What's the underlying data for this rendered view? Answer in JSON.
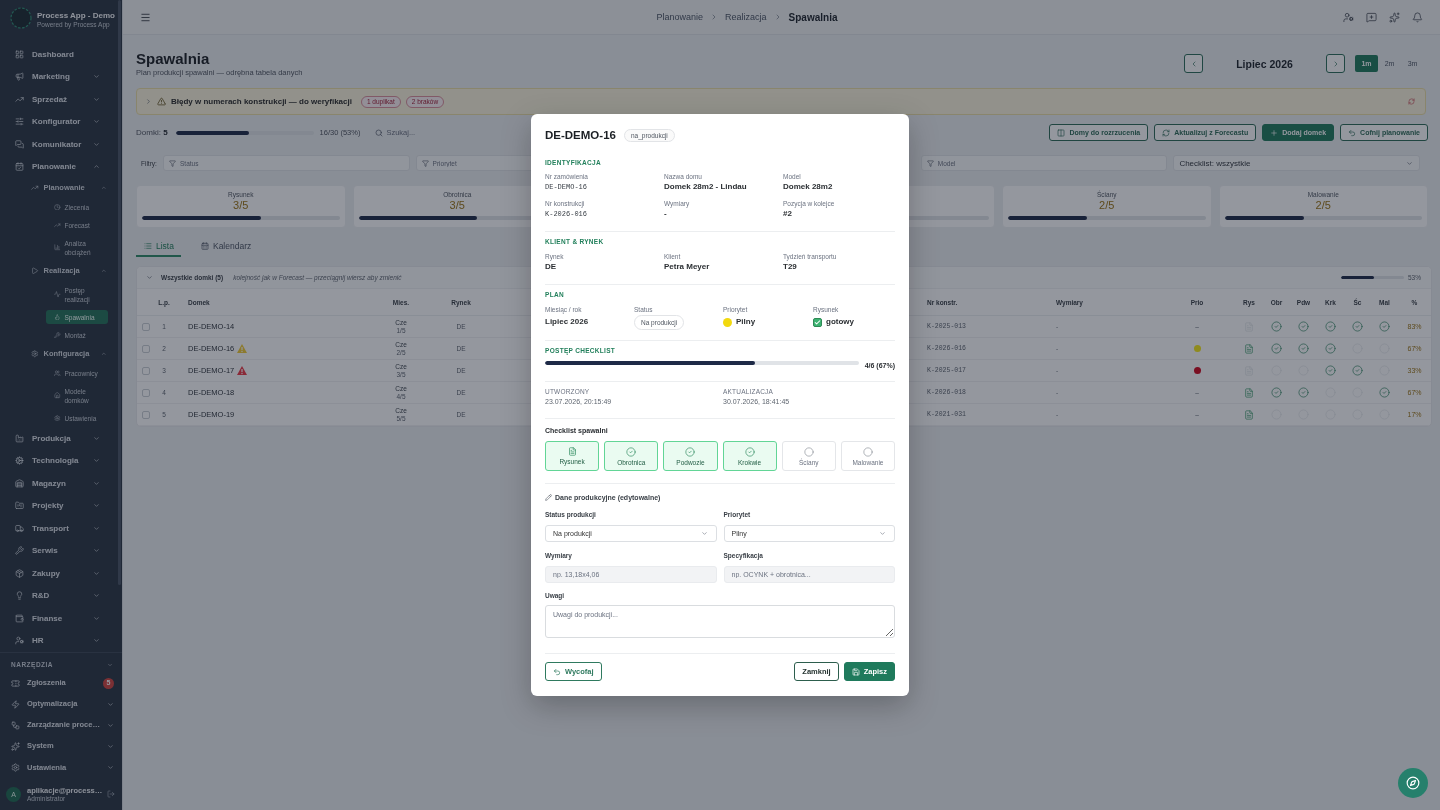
{
  "sidebar": {
    "brand": {
      "title": "Process App - Demo",
      "subtitle": "Powered by Process App"
    },
    "items": [
      {
        "kind": "link",
        "label": "Dashboard",
        "selected": false
      },
      {
        "kind": "group",
        "label": "Marketing",
        "expanded": false
      },
      {
        "kind": "group",
        "label": "Sprzedaż",
        "expanded": false
      },
      {
        "kind": "group",
        "label": "Konfigurator",
        "expanded": false
      },
      {
        "kind": "group",
        "label": "Komunikator",
        "expanded": false
      },
      {
        "kind": "group",
        "label": "Planowanie",
        "expanded": true,
        "children": [
          {
            "kind": "group",
            "label": "Planowanie",
            "expanded": true,
            "children": [
              {
                "kind": "link",
                "label": "Zlecenia",
                "selected": false
              },
              {
                "kind": "link",
                "label": "Forecast",
                "selected": false
              },
              {
                "kind": "link",
                "label": "Analiza obciążeń",
                "selected": false
              }
            ]
          },
          {
            "kind": "group",
            "label": "Realizacja",
            "expanded": true,
            "children": [
              {
                "kind": "link",
                "label": "Postęp realizacji",
                "selected": false
              },
              {
                "kind": "link",
                "label": "Spawalnia",
                "selected": true
              },
              {
                "kind": "link",
                "label": "Montaż",
                "selected": false
              }
            ]
          },
          {
            "kind": "group",
            "label": "Konfiguracja",
            "expanded": true,
            "children": [
              {
                "kind": "link",
                "label": "Pracownicy",
                "selected": false
              },
              {
                "kind": "link",
                "label": "Modele domków",
                "selected": false
              },
              {
                "kind": "link",
                "label": "Ustawienia",
                "selected": false
              }
            ]
          }
        ]
      },
      {
        "kind": "group",
        "label": "Produkcja",
        "expanded": false
      },
      {
        "kind": "group",
        "label": "Technologia",
        "expanded": false
      },
      {
        "kind": "group",
        "label": "Magazyn",
        "expanded": false
      },
      {
        "kind": "group",
        "label": "Projekty",
        "expanded": false
      },
      {
        "kind": "group",
        "label": "Transport",
        "expanded": false
      },
      {
        "kind": "group",
        "label": "Serwis",
        "expanded": false
      },
      {
        "kind": "group",
        "label": "Zakupy",
        "expanded": false
      },
      {
        "kind": "group",
        "label": "R&D",
        "expanded": false
      },
      {
        "kind": "group",
        "label": "Finanse",
        "expanded": false
      },
      {
        "kind": "group",
        "label": "HR",
        "expanded": false
      }
    ],
    "tools": {
      "title": "NARZĘDZIA",
      "items": [
        {
          "kind": "link",
          "label": "Zgłoszenia",
          "selected": false,
          "badge": "5"
        },
        {
          "kind": "group",
          "label": "Optymalizacja",
          "expanded": false
        },
        {
          "kind": "group",
          "label": "Zarządzanie proce…",
          "expanded": false
        },
        {
          "kind": "group",
          "label": "System",
          "expanded": false
        },
        {
          "kind": "group",
          "label": "Ustawienia",
          "expanded": false
        }
      ]
    },
    "user": {
      "initial": "A",
      "email": "aplikacje@process…",
      "role": "Administrator"
    }
  },
  "breadcrumb": [
    {
      "label": "Planowanie",
      "current": false
    },
    {
      "label": "Realizacja",
      "current": false
    },
    {
      "label": "Spawalnia",
      "current": true
    }
  ],
  "page": {
    "title": "Spawalnia",
    "subtitle": "Plan produkcji spawalni — odrębna tabela danych"
  },
  "period": {
    "label": "Lipiec 2026",
    "ranges": [
      {
        "label": "1m",
        "selected": true
      },
      {
        "label": "2m",
        "selected": false
      },
      {
        "label": "3m",
        "selected": false
      }
    ]
  },
  "banner": {
    "expanded": false,
    "text": "Błędy w numerach konstrukcji — do weryfikacji",
    "badges": [
      "1 duplikat",
      "2 braków"
    ]
  },
  "summary": {
    "label": "Domki: **5**",
    "level": 0.53,
    "reading": "16/30 (53%)",
    "search": {
      "placeholder": "Szukaj..."
    }
  },
  "actions": [
    {
      "kind": "outline",
      "label": "Domy do rozrzucenia"
    },
    {
      "kind": "outline",
      "label": "Aktualizuj z Forecastu"
    },
    {
      "kind": "primary",
      "label": "Dodaj domek"
    },
    {
      "kind": "outline",
      "label": "Cofnij planowanie"
    }
  ],
  "filters": {
    "label": "Filtry:",
    "fields_left": [
      {
        "placeholder": "Status"
      },
      {
        "placeholder": "Priorytet"
      }
    ],
    "fields_right": [
      {
        "placeholder": "Model"
      }
    ],
    "checklist": {
      "value": "Checklist: wszystkie"
    }
  },
  "stats": {
    "left": [
      {
        "label": "Rysunek",
        "value": "3/5",
        "level": 0.6
      },
      {
        "label": "Obrotnica",
        "value": "3/5",
        "level": 0.6
      }
    ],
    "right": [
      {
        "label": "Ściany",
        "value": "2/5",
        "level": 0.4
      },
      {
        "label": "Malowanie",
        "value": "2/5",
        "level": 0.4
      }
    ]
  },
  "tabs": [
    {
      "label": "Lista",
      "selected": true
    },
    {
      "label": "Kalendarz",
      "selected": false
    }
  ],
  "table": {
    "group": {
      "expanded": true,
      "title": "Wszystkie domki (5)",
      "note": "kolejność jak w Forecast — przeciągnij wiersz aby zmienić",
      "level": 0.53,
      "reading": "53%"
    },
    "columns_left": [
      "L.p.",
      "Domek",
      "Mies.",
      "Rynek"
    ],
    "columns_right": [
      "Nr konstr.",
      "Wymiary",
      "Prio",
      "Rys",
      "Obr",
      "Pdw",
      "Krk",
      "Śc",
      "Mal",
      "%"
    ],
    "rows": [
      {
        "checked": false,
        "lp": "1",
        "house": "DE-DEMO-14",
        "month": "Cze",
        "sequence": "1/5",
        "market": "DE",
        "construction_no": "K-2025-013",
        "dimensions": "-",
        "priority": {
          "kind": "none",
          "text": "–"
        },
        "drawing": false,
        "checks": [
          true,
          true,
          true,
          true,
          true
        ],
        "percent": "83%"
      },
      {
        "checked": false,
        "lp": "2",
        "house": "DE-DEMO-16",
        "alert": {
          "color": "#8c7a2e"
        },
        "month": "Cze",
        "sequence": "2/5",
        "market": "DE",
        "construction_no": "K-2026-016",
        "dimensions": "-",
        "priority": {
          "kind": "dot",
          "color": "#8f8b1e"
        },
        "drawing": true,
        "checks": [
          true,
          true,
          true,
          false,
          false
        ],
        "percent": "67%"
      },
      {
        "checked": false,
        "lp": "3",
        "house": "DE-DEMO-17",
        "alert": {
          "color": "#8a2a38"
        },
        "month": "Cze",
        "sequence": "3/5",
        "market": "DE",
        "construction_no": "K-2025-017",
        "dimensions": "-",
        "priority": {
          "kind": "dot",
          "color": "#7a0f22"
        },
        "drawing": false,
        "checks": [
          false,
          false,
          true,
          true,
          false
        ],
        "percent": "33%"
      },
      {
        "checked": false,
        "lp": "4",
        "house": "DE-DEMO-18",
        "month": "Cze",
        "sequence": "4/5",
        "market": "DE",
        "construction_no": "K-2026-018",
        "dimensions": "-",
        "priority": {
          "kind": "none",
          "text": "–"
        },
        "drawing": true,
        "checks": [
          true,
          true,
          false,
          false,
          true
        ],
        "percent": "67%"
      },
      {
        "checked": false,
        "lp": "5",
        "house": "DE-DEMO-19",
        "month": "Cze",
        "sequence": "5/5",
        "market": "DE",
        "construction_no": "K-2021-031",
        "dimensions": "-",
        "priority": {
          "kind": "none",
          "text": "–"
        },
        "drawing": true,
        "checks": [
          false,
          false,
          false,
          false,
          false
        ],
        "percent": "17%"
      }
    ]
  },
  "modal": {
    "title": "DE-DEMO-16",
    "status_badge": "na_produkcji",
    "identification": {
      "title": "IDENTYFIKACJA",
      "fields": [
        {
          "kind": "code",
          "label": "Nr zamówienia",
          "value": "DE-DEMO-16"
        },
        {
          "kind": "text",
          "label": "Nazwa domu",
          "value": "Domek 28m2 - Lindau"
        },
        {
          "kind": "text",
          "label": "Model",
          "value": "Domek 28m2"
        },
        {
          "kind": "code",
          "label": "Nr konstrukcji",
          "value": "K-2026-016"
        },
        {
          "kind": "text",
          "label": "Wymiary",
          "value": "-"
        },
        {
          "kind": "text",
          "label": "Pozycja w kolejce",
          "value": "#2"
        }
      ]
    },
    "client": {
      "title": "KLIENT & RYNEK",
      "fields": [
        {
          "kind": "text",
          "label": "Rynek",
          "value": "DE"
        },
        {
          "kind": "text",
          "label": "Klient",
          "value": "Petra Meyer"
        },
        {
          "kind": "text",
          "label": "Tydzień transportu",
          "value": "T29"
        }
      ]
    },
    "plan": {
      "title": "PLAN",
      "items": [
        {
          "kind": "text",
          "label": "Miesiąc / rok",
          "value": "Lipiec 2026"
        },
        {
          "kind": "pill",
          "label": "Status",
          "value": "Na produkcji"
        },
        {
          "kind": "dot",
          "label": "Priorytet",
          "value": "Pilny",
          "color": "#f2d90f"
        },
        {
          "kind": "check",
          "label": "Rysunek",
          "value": "gotowy",
          "checked": true
        }
      ]
    },
    "progress": {
      "title": "POSTĘP CHECKLIST",
      "level": 0.67,
      "reading": "4/6 (67%)"
    },
    "dates": [
      {
        "label": "UTWORZONY",
        "value": "23.07.2026, 20:15:49"
      },
      {
        "label": "AKTUALIZACJA",
        "value": "30.07.2026, 18:41:45"
      }
    ],
    "checklist": {
      "title": "Checklist spawalni",
      "items": [
        {
          "kind": "document",
          "label": "Rysunek",
          "done": true
        },
        {
          "kind": "step",
          "label": "Obrotnica",
          "done": true
        },
        {
          "kind": "step",
          "label": "Podwozie",
          "done": true
        },
        {
          "kind": "step",
          "label": "Krokwie",
          "done": true
        },
        {
          "kind": "step",
          "label": "Ściany",
          "done": false
        },
        {
          "kind": "step",
          "label": "Malowanie",
          "done": false
        }
      ]
    },
    "edit": {
      "title": "Dane produkcyjne (edytowalne)",
      "fields": [
        {
          "kind": "select",
          "label": "Status produkcji",
          "value": "Na produkcji"
        },
        {
          "kind": "select",
          "label": "Priorytet",
          "value": "Pilny"
        },
        {
          "kind": "input",
          "label": "Wymiary",
          "placeholder": "np. 13,18x4,06"
        },
        {
          "kind": "input",
          "label": "Specyfikacja",
          "placeholder": "np. OCYNK + obrotnica..."
        },
        {
          "kind": "textarea",
          "label": "Uwagi",
          "placeholder": "Uwagi do produkcji..."
        }
      ]
    },
    "buttons": [
      {
        "kind": "revert",
        "label": "Wycofaj"
      },
      {
        "kind": "secondary",
        "label": "Zamknij"
      },
      {
        "kind": "primary",
        "label": "Zapisz"
      }
    ]
  }
}
